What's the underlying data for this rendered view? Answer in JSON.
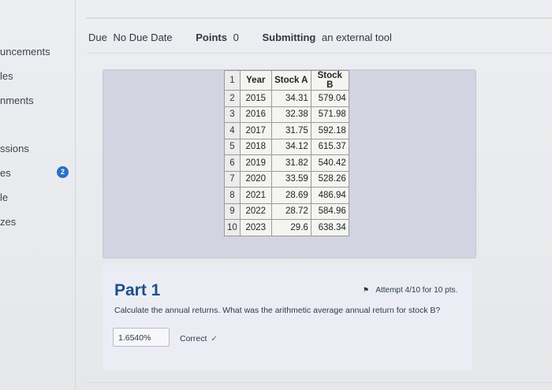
{
  "nav": {
    "items": [
      "uncements",
      "les",
      "nments",
      "ssions",
      "es",
      "le",
      "zes"
    ]
  },
  "meta": {
    "due_label": "Due",
    "due_value": "No Due Date",
    "points_label": "Points",
    "points_value": "0",
    "submitting_label": "Submitting",
    "submitting_value": "an external tool"
  },
  "badge": {
    "count": "2"
  },
  "sheet": {
    "rows": [
      [
        "1",
        "Year",
        "Stock A",
        "Stock B"
      ],
      [
        "2",
        "2015",
        "34.31",
        "579.04"
      ],
      [
        "3",
        "2016",
        "32.38",
        "571.98"
      ],
      [
        "4",
        "2017",
        "31.75",
        "592.18"
      ],
      [
        "5",
        "2018",
        "34.12",
        "615.37"
      ],
      [
        "6",
        "2019",
        "31.82",
        "540.42"
      ],
      [
        "7",
        "2020",
        "33.59",
        "528.26"
      ],
      [
        "8",
        "2021",
        "28.69",
        "486.94"
      ],
      [
        "9",
        "2022",
        "28.72",
        "584.96"
      ],
      [
        "10",
        "2023",
        "29.6",
        "638.34"
      ]
    ]
  },
  "part": {
    "title": "Part 1",
    "attempt": "Attempt 4/10 for 10 pts.",
    "question": "Calculate the annual returns. What was the arithmetic average annual return for stock B?",
    "answer_value": "1.6540%",
    "status": "Correct"
  },
  "colors": {
    "accent": "#1e4f8a",
    "badge": "#2b6fc4",
    "panel": "#d2d4e2"
  },
  "icons": {
    "flag": "flag-icon",
    "check": "check-icon"
  }
}
